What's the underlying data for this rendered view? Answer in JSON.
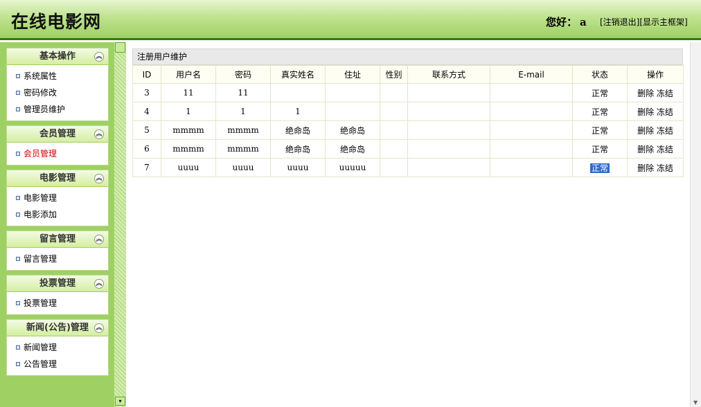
{
  "header": {
    "title": "在线电影网",
    "greeting": "您好：",
    "username": "a",
    "logout_link": "[注销退出]",
    "show_frame_link": "[显示主框架]"
  },
  "sidebar": {
    "panels": [
      {
        "title": "基本操作",
        "items": [
          "系统属性",
          "密码修改",
          "管理员维护"
        ]
      },
      {
        "title": "会员管理",
        "items": [
          "会员管理"
        ]
      },
      {
        "title": "电影管理",
        "items": [
          "电影管理",
          "电影添加"
        ]
      },
      {
        "title": "留言管理",
        "items": [
          "留言管理"
        ]
      },
      {
        "title": "投票管理",
        "items": [
          "投票管理"
        ]
      },
      {
        "title": "新闻(公告)管理",
        "items": [
          "新闻管理",
          "公告管理"
        ]
      }
    ]
  },
  "main": {
    "panel_title": "注册用户维护",
    "columns": [
      "ID",
      "用户名",
      "密码",
      "真实姓名",
      "住址",
      "性别",
      "联系方式",
      "E-mail",
      "状态",
      "操作"
    ],
    "rows": [
      {
        "id": "3",
        "username": "11",
        "password": "11",
        "realname": "",
        "address": "",
        "gender": "",
        "contact": "",
        "email": "",
        "status": "正常",
        "delete": "删除",
        "freeze": "冻结"
      },
      {
        "id": "4",
        "username": "1",
        "password": "1",
        "realname": "1",
        "address": "",
        "gender": "",
        "contact": "",
        "email": "",
        "status": "正常",
        "delete": "删除",
        "freeze": "冻结"
      },
      {
        "id": "5",
        "username": "mmmm",
        "password": "mmmm",
        "realname": "绝命岛",
        "address": "绝命岛",
        "gender": "",
        "contact": "",
        "email": "",
        "status": "正常",
        "delete": "删除",
        "freeze": "冻结"
      },
      {
        "id": "6",
        "username": "mmmm",
        "password": "mmmm",
        "realname": "绝命岛",
        "address": "绝命岛",
        "gender": "",
        "contact": "",
        "email": "",
        "status": "正常",
        "delete": "删除",
        "freeze": "冻结"
      },
      {
        "id": "7",
        "username": "uuuu",
        "password": "uuuu",
        "realname": "uuuu",
        "address": "uuuuu",
        "gender": "",
        "contact": "",
        "email": "",
        "status": "正常",
        "delete": "删除",
        "freeze": "冻结"
      }
    ]
  }
}
